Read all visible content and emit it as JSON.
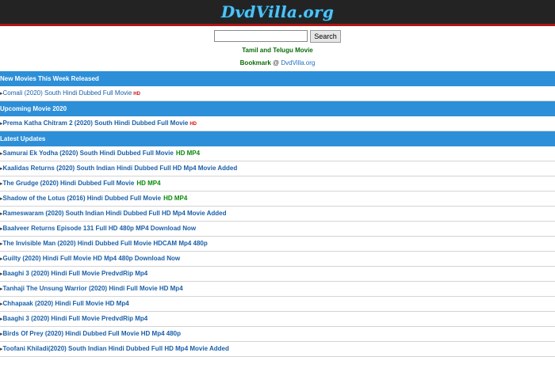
{
  "header": {
    "logo": "DvdVilla.org"
  },
  "search": {
    "placeholder": "",
    "button_label": "Search"
  },
  "tagline": "Tamil and Telugu Movie",
  "bookmark": {
    "label": "Bookmark",
    "at": " @ ",
    "site": "DvdVilla.org"
  },
  "sections": {
    "new_week": {
      "title": "New Movies This Week Released",
      "items": [
        {
          "title": "Comali (2020) South Hindi Dubbed Full Movie",
          "badge": "HD"
        }
      ]
    },
    "upcoming": {
      "title": "Upcoming Movie 2020",
      "items": [
        {
          "title": "Prema Katha Chitram 2 (2020) South Hindi Dubbed Full Movie",
          "badge": "HD"
        }
      ]
    },
    "latest": {
      "title": "Latest Updates",
      "items": [
        {
          "title": "Samurai Ek Yodha (2020) South Hindi Dubbed Full Movie",
          "badge": "HD MP4"
        },
        {
          "title": "Kaalidas Returns (2020) South Indian Hindi Dubbed Full HD Mp4 Movie Added",
          "badge": ""
        },
        {
          "title": "The Grudge (2020) Hindi Dubbed Full Movie",
          "badge": "HD MP4"
        },
        {
          "title": "Shadow of the Lotus (2016) Hindi Dubbed Full Movie",
          "badge": "HD MP4"
        },
        {
          "title": "Rameswaram (2020) South Indian Hindi Dubbed Full HD Mp4 Movie Added",
          "badge": ""
        },
        {
          "title": "Baalveer Returns Episode 131 Full HD 480p MP4 Download Now",
          "badge": ""
        },
        {
          "title": "The Invisible Man (2020) Hindi Dubbed Full Movie HDCAM Mp4 480p",
          "badge": ""
        },
        {
          "title": "Guilty (2020) Hindi Full Movie HD Mp4 480p Download Now",
          "badge": ""
        },
        {
          "title": "Baaghi 3 (2020) Hindi Full Movie PredvdRip Mp4",
          "badge": ""
        },
        {
          "title": "Tanhaji The Unsung Warrior (2020) Hindi Full Movie HD Mp4",
          "badge": ""
        },
        {
          "title": "Chhapaak (2020) Hindi Full Movie HD Mp4",
          "badge": ""
        },
        {
          "title": "Baaghi 3 (2020) Hindi Full Movie PredvdRip Mp4",
          "badge": ""
        },
        {
          "title": "Birds Of Prey (2020) Hindi Dubbed Full Movie HD Mp4 480p",
          "badge": ""
        },
        {
          "title": "Toofani Khiladi(2020) South Indian Hindi Dubbed Full HD Mp4 Movie Added",
          "badge": ""
        }
      ]
    }
  },
  "colors": {
    "section_bg": "#2d8fd8",
    "header_bg": "#232323",
    "accent_red": "#b01515",
    "link": "#1a5fa8",
    "hd_green": "#0a8a0a"
  }
}
